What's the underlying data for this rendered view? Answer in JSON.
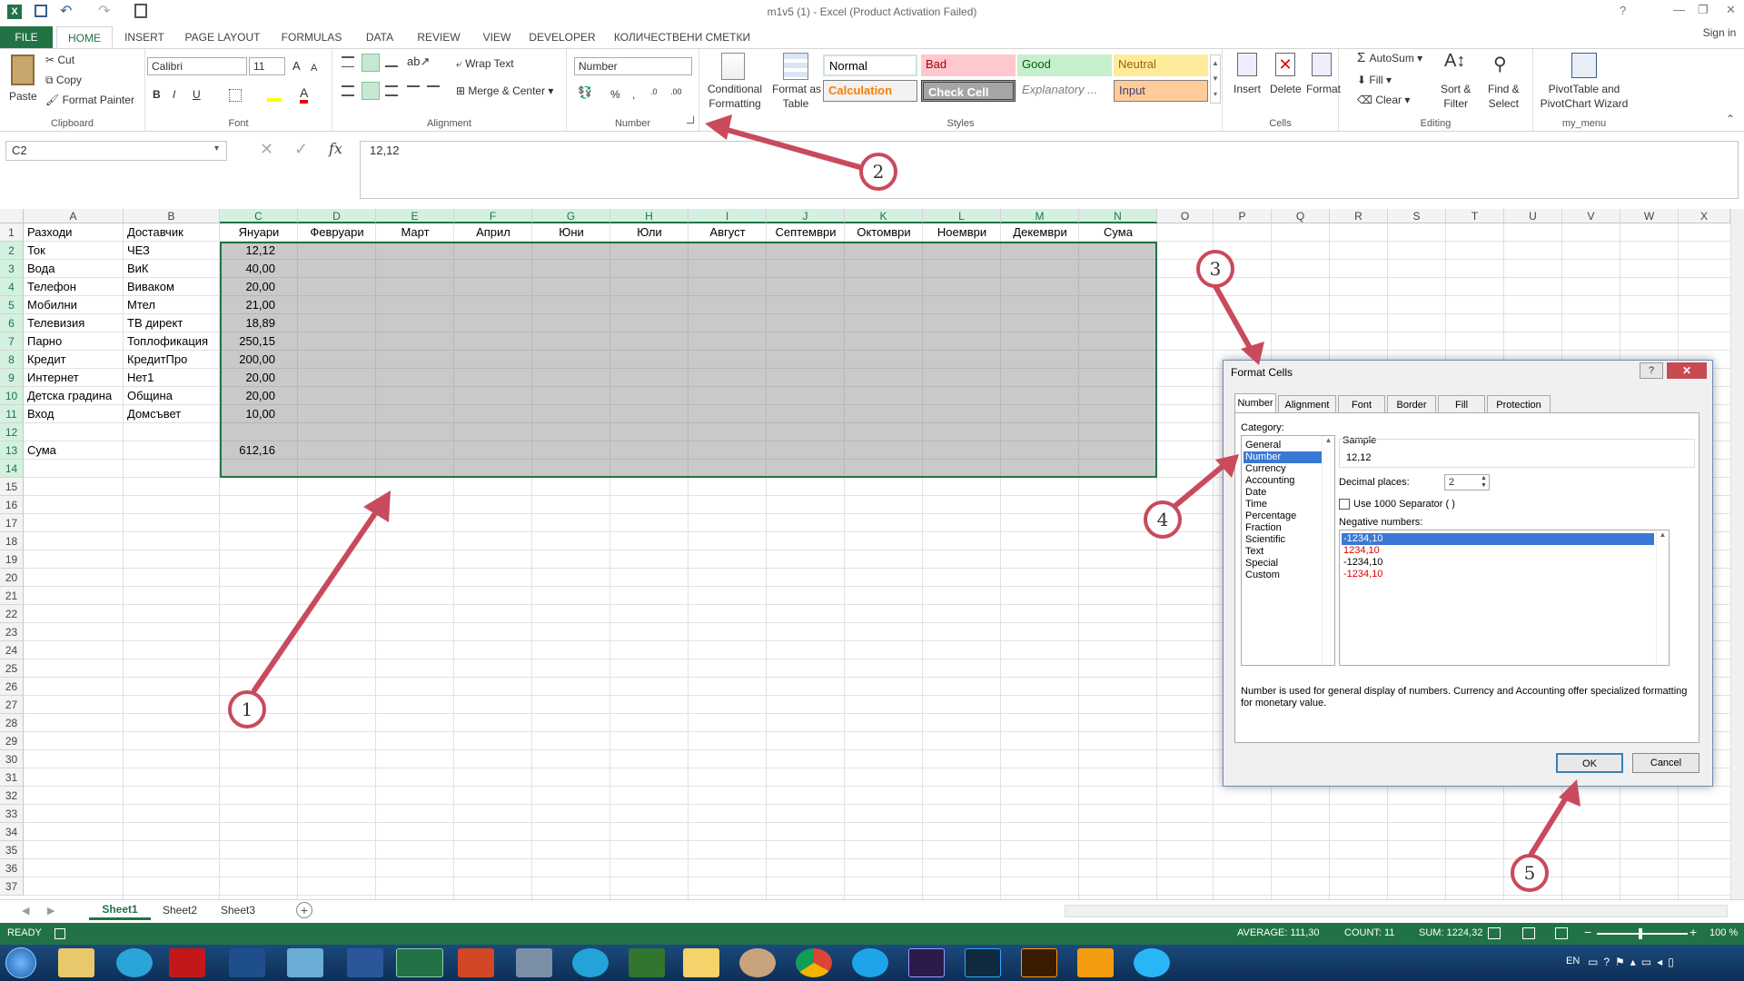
{
  "titlebar": {
    "title": "m1v5 (1) - Excel (Product Activation Failed)",
    "signin": "Sign in",
    "help": "?",
    "min": "—",
    "restore": "❐",
    "close": "✕"
  },
  "tabs": [
    "FILE",
    "HOME",
    "INSERT",
    "PAGE LAYOUT",
    "FORMULAS",
    "DATA",
    "REVIEW",
    "VIEW",
    "DEVELOPER",
    "КОЛИЧЕСТВЕНИ СМЕТКИ"
  ],
  "ribbon": {
    "clipboard": {
      "label": "Clipboard",
      "paste": "Paste",
      "cut": "Cut",
      "copy": "Copy",
      "painter": "Format Painter"
    },
    "font": {
      "label": "Font",
      "name": "Calibri",
      "size": "11",
      "bold": "B",
      "italic": "I",
      "underline": "U"
    },
    "alignment": {
      "label": "Alignment",
      "wrap": "Wrap Text",
      "merge": "Merge & Center"
    },
    "number": {
      "label": "Number",
      "format": "Number",
      "percent": "%",
      "comma": ","
    },
    "styles": {
      "label": "Styles",
      "cond1": "Conditional",
      "cond2": "Formatting",
      "fmt1": "Format as",
      "fmt2": "Table",
      "normal": "Normal",
      "bad": "Bad",
      "good": "Good",
      "neutral": "Neutral",
      "calculation": "Calculation",
      "check": "Check Cell",
      "explanatory": "Explanatory ...",
      "input": "Input"
    },
    "cells": {
      "label": "Cells",
      "insert": "Insert",
      "delete": "Delete",
      "format": "Format"
    },
    "editing": {
      "label": "Editing",
      "autosum": "AutoSum",
      "fill": "Fill",
      "clear": "Clear",
      "sort1": "Sort &",
      "sort2": "Filter",
      "find1": "Find &",
      "find2": "Select"
    },
    "mymenu": {
      "label": "my_menu",
      "pivot1": "PivotTable and",
      "pivot2": "PivotChart Wizard"
    }
  },
  "formula_bar": {
    "namebox": "C2",
    "value": "12,12",
    "fx": "fx"
  },
  "columns": [
    "A",
    "B",
    "C",
    "D",
    "E",
    "F",
    "G",
    "H",
    "I",
    "J",
    "K",
    "L",
    "M",
    "N",
    "O",
    "P",
    "Q",
    "R",
    "S",
    "T",
    "U",
    "V",
    "W",
    "X"
  ],
  "header_row": [
    "Разходи",
    "Доставчик",
    "Януари",
    "Февруари",
    "Март",
    "Април",
    "Юни",
    "Юли",
    "Август",
    "Септември",
    "Октомври",
    "Ноември",
    "Декември",
    "Сума"
  ],
  "data_rows": [
    [
      "Ток",
      "ЧЕЗ",
      "12,12"
    ],
    [
      "Вода",
      "ВиК",
      "40,00"
    ],
    [
      "Телефон",
      "Виваком",
      "20,00"
    ],
    [
      "Мобилни",
      "Мтел",
      "21,00"
    ],
    [
      "Телевизия",
      "ТВ директ",
      "18,89"
    ],
    [
      "Парно",
      "Топлофикация",
      "250,15"
    ],
    [
      "Кредит",
      "КредитПро",
      "200,00"
    ],
    [
      "Интернет",
      "Нет1",
      "20,00"
    ],
    [
      "Детска градина",
      "Община",
      "20,00"
    ],
    [
      "Вход",
      "Домсъвет",
      "10,00"
    ]
  ],
  "sum_row": [
    "Сума",
    "",
    "612,16"
  ],
  "row_count": 37,
  "sheets": [
    "Sheet1",
    "Sheet2",
    "Sheet3"
  ],
  "status": {
    "ready": "READY",
    "average": "AVERAGE: 111,30",
    "count": "COUNT: 11",
    "sum": "SUM: 1224,32",
    "zoom": "100 %"
  },
  "taskbar": {
    "lang": "EN"
  },
  "dialog": {
    "title": "Format Cells",
    "help": "?",
    "close": "✕",
    "tabs": [
      "Number",
      "Alignment",
      "Font",
      "Border",
      "Fill",
      "Protection"
    ],
    "category_label": "Category:",
    "categories": [
      "General",
      "Number",
      "Currency",
      "Accounting",
      "Date",
      "Time",
      "Percentage",
      "Fraction",
      "Scientific",
      "Text",
      "Special",
      "Custom"
    ],
    "selected_category": "Number",
    "sample_label": "Sample",
    "sample_value": "12,12",
    "decimal_label": "Decimal places:",
    "decimal_value": "2",
    "separator_label": "Use 1000 Separator ( )",
    "negative_label": "Negative numbers:",
    "negatives": [
      "-1234,10",
      "1234,10",
      "-1234,10",
      "-1234,10"
    ],
    "description": "Number is used for general display of numbers.  Currency and Accounting offer specialized formatting for monetary value.",
    "ok": "OK",
    "cancel": "Cancel"
  },
  "annotations": [
    "1",
    "2",
    "3",
    "4",
    "5"
  ]
}
